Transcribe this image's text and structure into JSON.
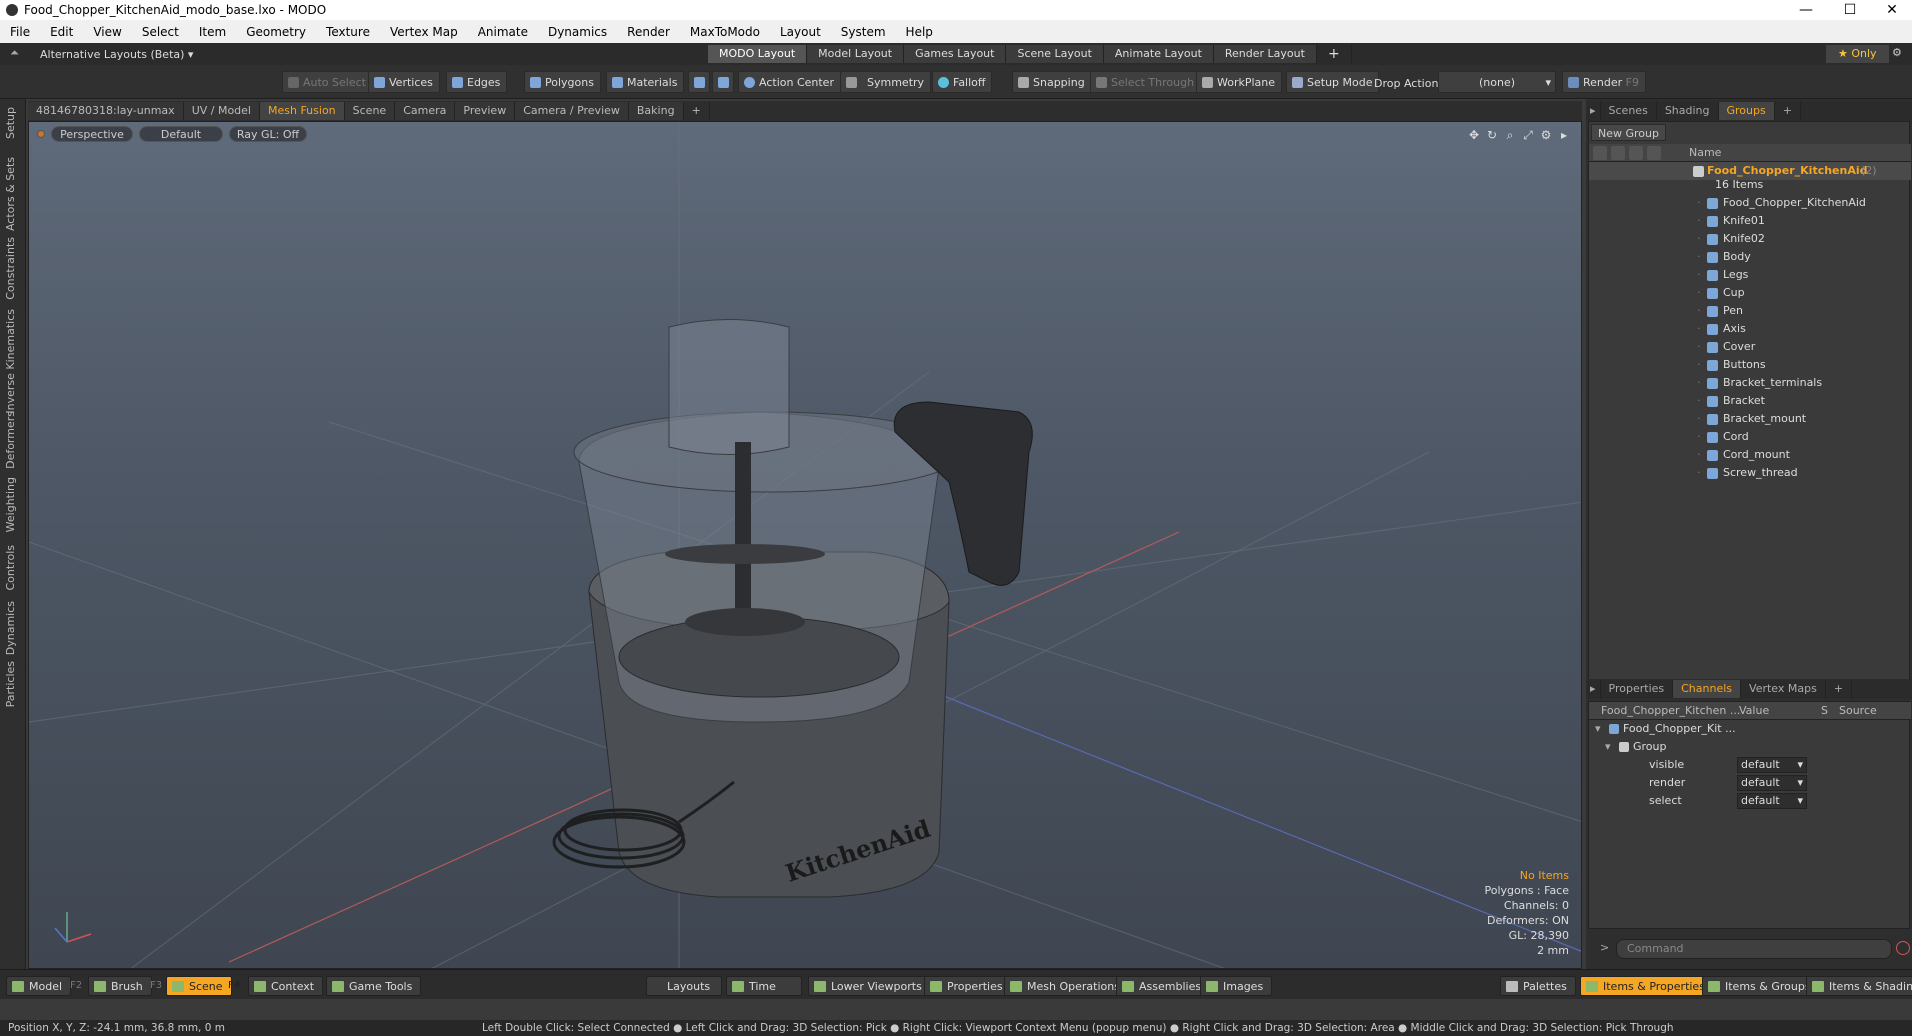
{
  "window": {
    "title": "Food_Chopper_KitchenAid_modo_base.lxo - MODO",
    "minimize": "—",
    "maximize": "☐",
    "close": "✕"
  },
  "menu": [
    "File",
    "Edit",
    "View",
    "Select",
    "Item",
    "Geometry",
    "Texture",
    "Vertex Map",
    "Animate",
    "Dynamics",
    "Render",
    "MaxToModo",
    "Layout",
    "System",
    "Help"
  ],
  "layouts": {
    "alt_label": "Alternative Layouts (Beta) ▾",
    "tabs": [
      "MODO Layout",
      "Model Layout",
      "Games Layout",
      "Scene Layout",
      "Animate Layout",
      "Render Layout"
    ],
    "active": "MODO Layout",
    "add": "+",
    "only": "★  Only"
  },
  "toolbar": {
    "auto_select": "Auto Select",
    "vertices": "Vertices",
    "edges": "Edges",
    "polygons": "Polygons",
    "materials": "Materials",
    "action_center": "Action Center",
    "symmetry": "Symmetry",
    "falloff": "Falloff",
    "snapping": "Snapping",
    "select_through": "Select Through",
    "workplane": "WorkPlane",
    "setup_mode": "Setup Mode",
    "drop_action": "Drop Action",
    "drop_value": "(none)",
    "render": "Render",
    "render_key": "F9"
  },
  "left_tabs": [
    "Setup",
    "Actors & Sets",
    "Constraints",
    "Inverse Kinematics",
    "Deformers",
    "Weighting",
    "Controls",
    "Dynamics",
    "Particles"
  ],
  "viewport_tabs": [
    "48146780318:lay-unmax",
    "UV / Model",
    "Mesh Fusion",
    "Scene",
    "Camera",
    "Preview",
    "Camera / Preview",
    "Baking"
  ],
  "viewport_tab_active": "Mesh Fusion",
  "viewport": {
    "view": "Perspective",
    "shading": "Default",
    "raygl": "Ray GL: Off",
    "brand": "KitchenAid",
    "stats": {
      "items": "No Items",
      "polygons": "Polygons : Face",
      "channels": "Channels: 0",
      "deformers": "Deformers: ON",
      "gl": "GL: 28,390",
      "scale": "2 mm"
    }
  },
  "right_tabs": {
    "tabs": [
      "Scenes",
      "Shading",
      "Groups"
    ],
    "active": "Groups"
  },
  "groups": {
    "new_group": "New Group",
    "col_name": "Name",
    "root": "Food_Chopper_KitchenAid",
    "root_count": "(2)",
    "item_count": "16 Items",
    "items": [
      "Food_Chopper_KitchenAid",
      "Knife01",
      "Knife02",
      "Body",
      "Legs",
      "Cup",
      "Pen",
      "Axis",
      "Cover",
      "Buttons",
      "Bracket_terminals",
      "Bracket",
      "Bracket_mount",
      "Cord",
      "Cord_mount",
      "Screw_thread"
    ]
  },
  "props_tabs": {
    "tabs": [
      "Properties",
      "Channels",
      "Vertex Maps"
    ],
    "active": "Channels"
  },
  "channels": {
    "col_name": "Food_Chopper_Kitchen ...",
    "col_value": "Value",
    "col_s": "S",
    "col_source": "Source",
    "root": "Food_Chopper_Kit ...",
    "group": "Group",
    "rows": [
      {
        "name": "visible",
        "value": "default"
      },
      {
        "name": "render",
        "value": "default"
      },
      {
        "name": "select",
        "value": "default"
      }
    ]
  },
  "command": {
    "prompt": ">",
    "placeholder": "Command"
  },
  "bottom": {
    "model": "Model",
    "model_key": "F2",
    "brush": "Brush",
    "brush_key": "F3",
    "scene": "Scene",
    "scene_key": "F4",
    "context": "Context",
    "game_tools": "Game Tools",
    "layouts": "Layouts",
    "time": "Time",
    "lower_viewports": "Lower Viewports",
    "properties": "Properties",
    "mesh_operations": "Mesh Operations",
    "assemblies": "Assemblies",
    "images": "Images",
    "palettes": "Palettes",
    "items_properties": "Items & Properties",
    "items_groups": "Items & Groups",
    "items_shading": "Items & Shading"
  },
  "status": {
    "position": "Position X, Y, Z:   -24.1 mm, 36.8 mm, 0 m",
    "hints": "Left Double Click: Select Connected ● Left Click and Drag: 3D Selection: Pick ● Right Click: Viewport Context Menu (popup menu) ● Right Click and Drag: 3D Selection: Area ● Middle Click and Drag: 3D Selection: Pick Through"
  }
}
